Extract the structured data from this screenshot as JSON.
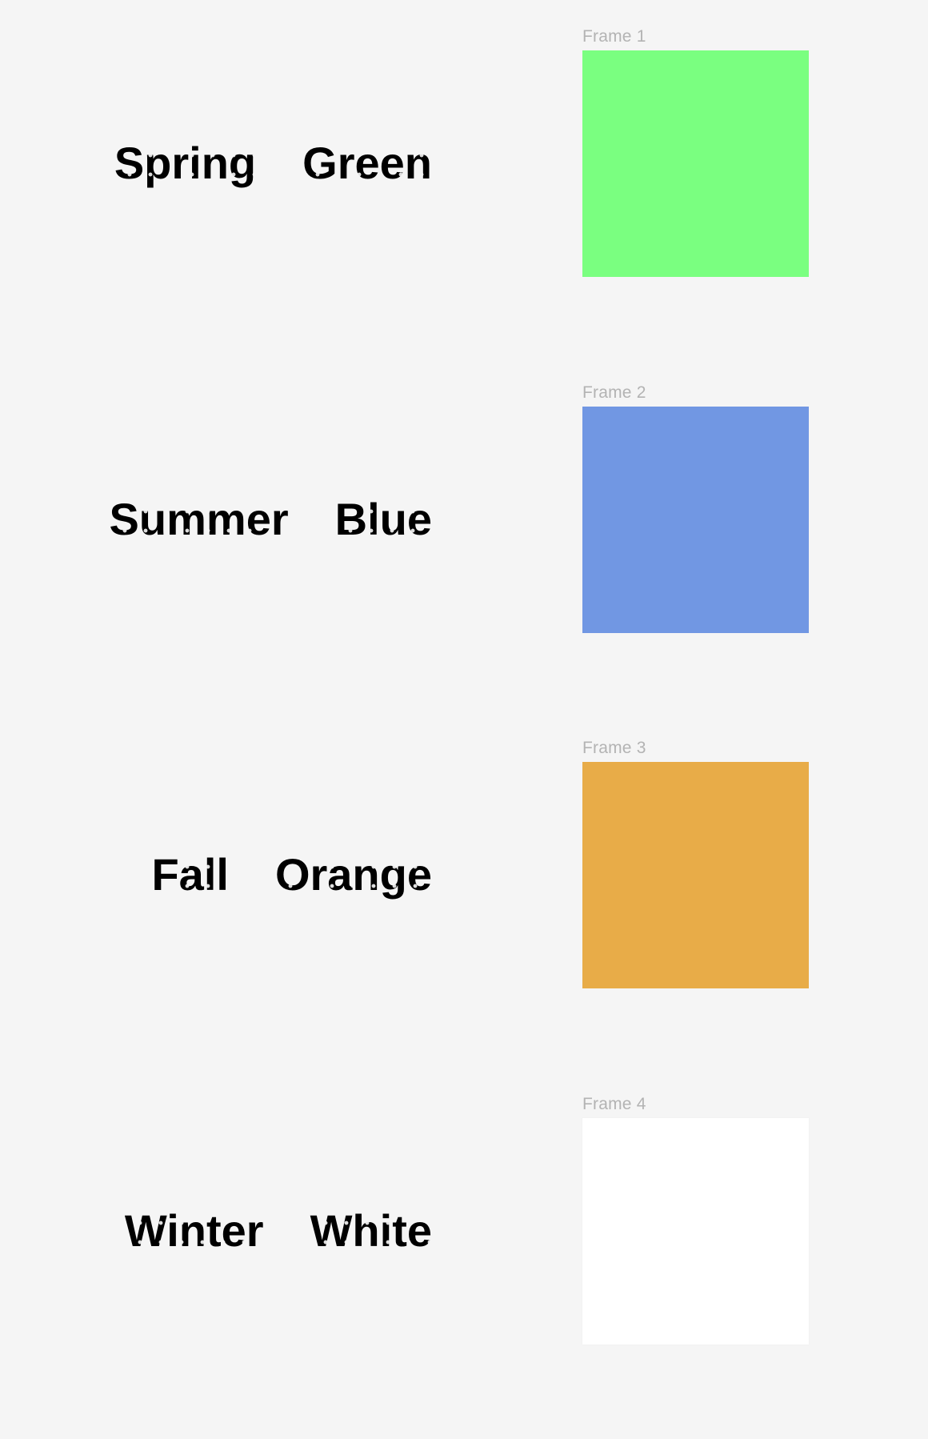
{
  "rows": [
    {
      "frame_label": "Frame 1",
      "word1": "Spring",
      "word2": "Green",
      "color": "#7aff80"
    },
    {
      "frame_label": "Frame 2",
      "word1": "Summer",
      "word2": "Blue",
      "color": "#7197e3"
    },
    {
      "frame_label": "Frame 3",
      "word1": "Fall",
      "word2": "Orange",
      "color": "#e8ac48"
    },
    {
      "frame_label": "Frame 4",
      "word1": "Winter",
      "word2": "White",
      "color": "#ffffff"
    }
  ]
}
